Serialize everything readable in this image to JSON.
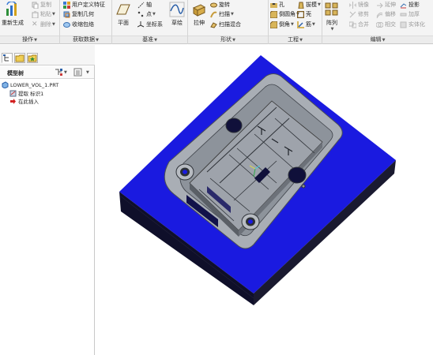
{
  "ribbon": {
    "operations": {
      "label": "操作",
      "regenerate": "重新生成",
      "copy": "复制",
      "paste": "粘贴",
      "delete": "删除"
    },
    "get_data": {
      "label": "获取数据",
      "udf": "用户定义特征",
      "copy_geometry": "复制几何",
      "shrinkwrap": "收缩包络"
    },
    "datum": {
      "label": "基准",
      "plane": "平面",
      "axis": "轴",
      "point": "点",
      "csys": "坐标系",
      "sketch": "草绘"
    },
    "shapes": {
      "label": "形状",
      "extrude": "拉伸",
      "revolve": "旋转",
      "sweep": "扫描",
      "swept_blend": "扫描混合"
    },
    "engineering": {
      "label": "工程",
      "hole": "孔",
      "round": "倒圆角",
      "chamfer": "倒角",
      "draft": "拔模",
      "shell": "壳",
      "rib": "筋"
    },
    "editing": {
      "label": "编辑",
      "pattern": "阵列",
      "mirror": "镜像",
      "trim": "修剪",
      "merge": "合并",
      "extend": "延伸",
      "offset": "偏移",
      "intersect": "相交",
      "project": "投影",
      "thicken": "加厚",
      "solidify": "实体化"
    }
  },
  "model_tree": {
    "title": "模型树",
    "items": [
      {
        "label": "LOWER_VOL_1.PRT"
      },
      {
        "label": "提取 标识1"
      },
      {
        "label": "在此插入"
      }
    ]
  },
  "colors": {
    "base_top": "#1a1ae0",
    "base_side": "#0f0f2a",
    "insert": "#9aa0a8",
    "ribbon_bg": "#f4f4f4"
  }
}
